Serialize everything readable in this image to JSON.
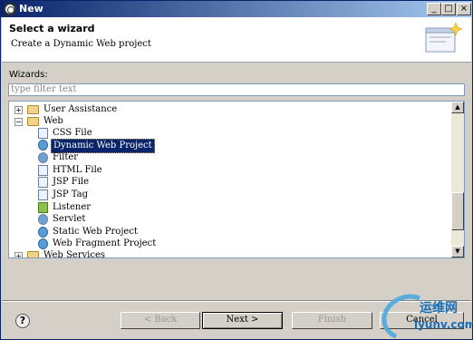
{
  "window": {
    "title": "New"
  },
  "title_buttons": {
    "minimize": "_",
    "maximize": "□",
    "close": "×"
  },
  "header": {
    "title": "Select a wizard",
    "description": "Create a Dynamic Web project"
  },
  "wizards_label": "Wizards:",
  "filter": {
    "placeholder": "type filter text",
    "value": ""
  },
  "tree": {
    "user_assistance": "User Assistance",
    "web": "Web",
    "web_children": [
      "CSS File",
      "Dynamic Web Project",
      "Filter",
      "HTML File",
      "JSP File",
      "JSP Tag",
      "Listener",
      "Servlet",
      "Static Web Project",
      "Web Fragment Project"
    ],
    "web_services": "Web Services",
    "selected": "Dynamic Web Project"
  },
  "buttons": {
    "back": "< Back",
    "next": "Next >",
    "finish": "Finish",
    "cancel": "Cancel"
  },
  "help_icon": "?",
  "watermark": {
    "brand": "运维网",
    "url": "iyunv.com"
  },
  "colors": {
    "selection": "#0a246a",
    "titlebar_start": "#0a246a",
    "titlebar_end": "#a6caf0"
  }
}
